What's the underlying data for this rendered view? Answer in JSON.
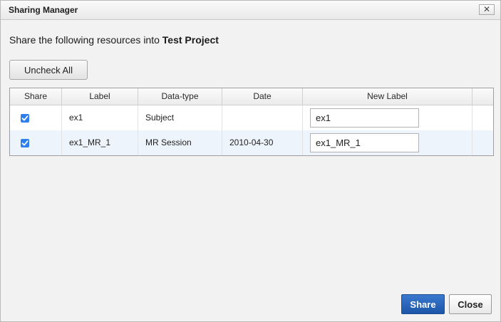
{
  "dialog": {
    "title": "Sharing Manager",
    "close_glyph": "✕"
  },
  "heading": {
    "prefix": "Share the following resources into ",
    "project": "Test Project"
  },
  "toolbar": {
    "uncheck_all_label": "Uncheck All"
  },
  "table": {
    "columns": [
      "Share",
      "Label",
      "Data-type",
      "Date",
      "New Label",
      ""
    ],
    "rows": [
      {
        "share": true,
        "label": "ex1",
        "data_type": "Subject",
        "date": "",
        "new_label": "ex1"
      },
      {
        "share": true,
        "label": "ex1_MR_1",
        "data_type": "MR Session",
        "date": "2010-04-30",
        "new_label": "ex1_MR_1"
      }
    ]
  },
  "footer": {
    "share_label": "Share",
    "close_label": "Close"
  },
  "colors": {
    "accent": "#2e7ef0",
    "primary_button": "#1d56a8",
    "selected_row": "#eef4fb"
  },
  "icons": [
    "close-icon",
    "checkbox-checked-icon"
  ]
}
